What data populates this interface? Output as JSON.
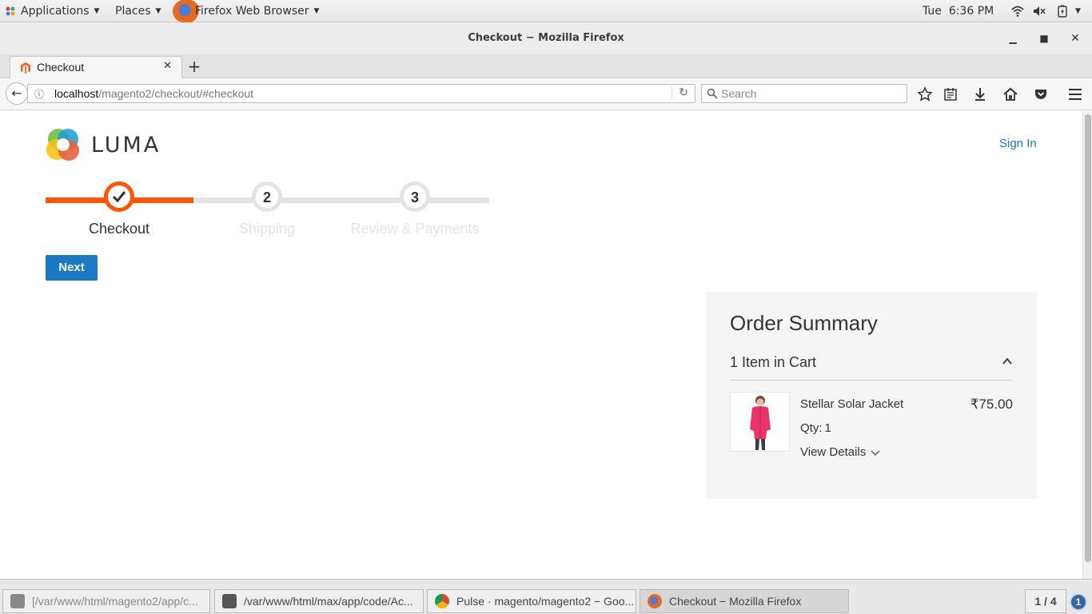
{
  "topbar": {
    "applications": "Applications",
    "places": "Places",
    "app_name": "Firefox Web Browser",
    "clock": "Tue  6:36 PM"
  },
  "window": {
    "title": "Checkout − Mozilla Firefox"
  },
  "tab": {
    "title": "Checkout"
  },
  "navbar": {
    "url_host": "localhost",
    "url_path": "/magento2/checkout/#checkout",
    "search_placeholder": "Search"
  },
  "page": {
    "logo_text": "LUMA",
    "sign_in": "Sign In",
    "steps": [
      {
        "number": "",
        "label": "Checkout",
        "state": "complete"
      },
      {
        "number": "2",
        "label": "Shipping",
        "state": "pending"
      },
      {
        "number": "3",
        "label": "Review & Payments",
        "state": "pending"
      }
    ],
    "next_button": "Next",
    "summary": {
      "title": "Order Summary",
      "cart_count": "1 Item in Cart",
      "item": {
        "name": "Stellar Solar Jacket",
        "price": "₹75.00",
        "qty_label": "Qty:",
        "qty": "1",
        "details_link": "View Details"
      }
    }
  },
  "taskbar": {
    "tasks": [
      {
        "label": "[/var/www/html/magento2/app/c...",
        "icon": "sublime-icon"
      },
      {
        "label": "/var/www/html/max/app/code/Ac...",
        "icon": "sublime-icon"
      },
      {
        "label": "Pulse · magento/magento2 − Goo...",
        "icon": "chrome-icon"
      },
      {
        "label": "Checkout − Mozilla Firefox",
        "icon": "firefox-icon"
      }
    ],
    "pager": "1 / 4",
    "notifications": "1"
  },
  "colors": {
    "accent_orange": "#ff5501",
    "link_blue": "#1979c3",
    "step_gray": "#e4e4e4"
  }
}
